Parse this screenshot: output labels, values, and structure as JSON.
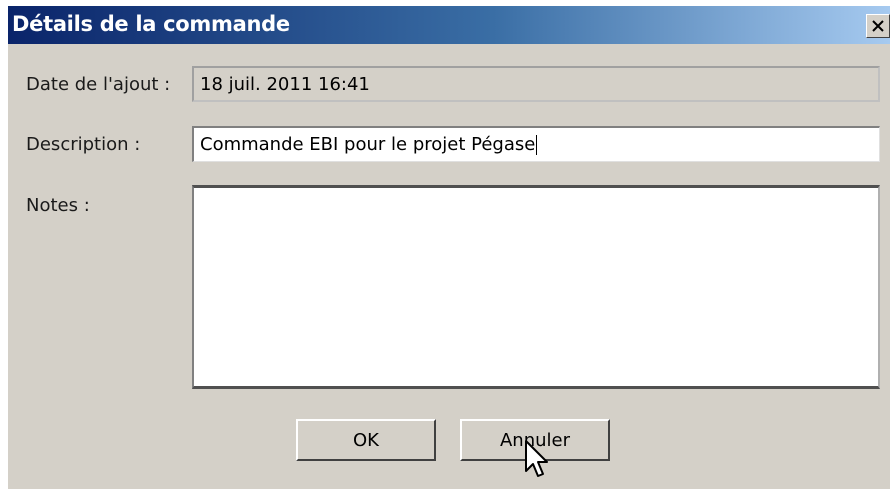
{
  "window": {
    "title": "Détails de la commande",
    "close_label": "×"
  },
  "form": {
    "date_label": "Date de l'ajout :",
    "date_value": "18 juil. 2011 16:41",
    "description_label": "Description :",
    "description_value": "Commande EBI pour le projet Pégase",
    "notes_label": "Notes :",
    "notes_value": ""
  },
  "buttons": {
    "ok_label": "OK",
    "cancel_label": "Annuler"
  },
  "colors": {
    "titlebar_start": "#0a246a",
    "titlebar_end": "#a6caf0",
    "dialog_bg": "#d4d0c8"
  }
}
